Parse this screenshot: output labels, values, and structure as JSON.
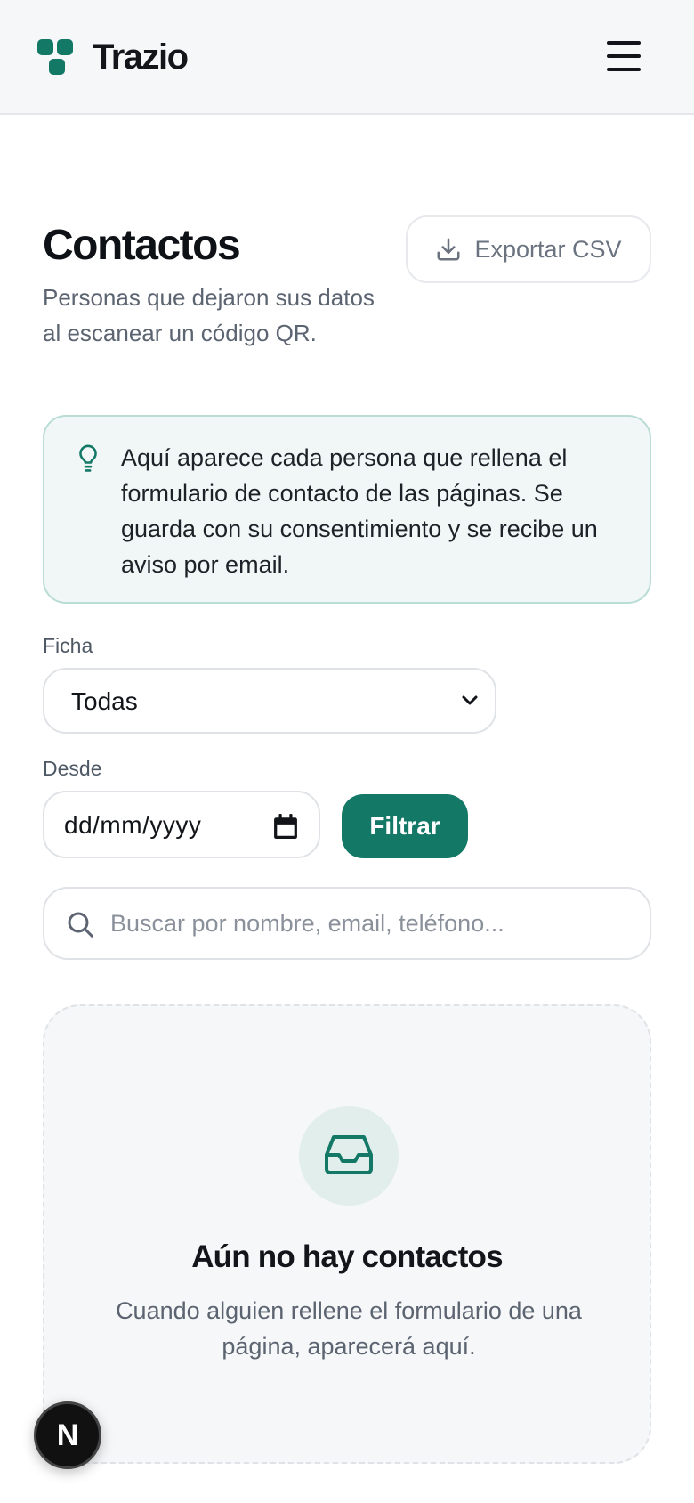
{
  "header": {
    "app_name": "Trazio",
    "brand_color": "#147867",
    "menu_icon": "hamburger-menu-icon"
  },
  "page": {
    "title": "Contactos",
    "subtitle": "Personas que dejaron sus datos al escanear un código QR.",
    "export_label": "Exportar CSV",
    "export_icon": "download-icon"
  },
  "tip": {
    "icon": "lightbulb-icon",
    "text": "Aquí aparece cada persona que rellena el formulario de contacto de las páginas. Se guarda con su consentimiento y se recibe un aviso por email."
  },
  "filters": {
    "ficha_label": "Ficha",
    "ficha_value": "Todas",
    "desde_label": "Desde",
    "desde_value": "dd/mm/yyyy",
    "filter_button": "Filtrar"
  },
  "search": {
    "placeholder": "Buscar por nombre, email, teléfono..."
  },
  "empty_state": {
    "icon": "inbox-icon",
    "title": "Aún no hay contactos",
    "message": "Cuando alguien rellene el formulario de una página, aparecerá aquí."
  },
  "dev_badge": {
    "letter": "N"
  }
}
